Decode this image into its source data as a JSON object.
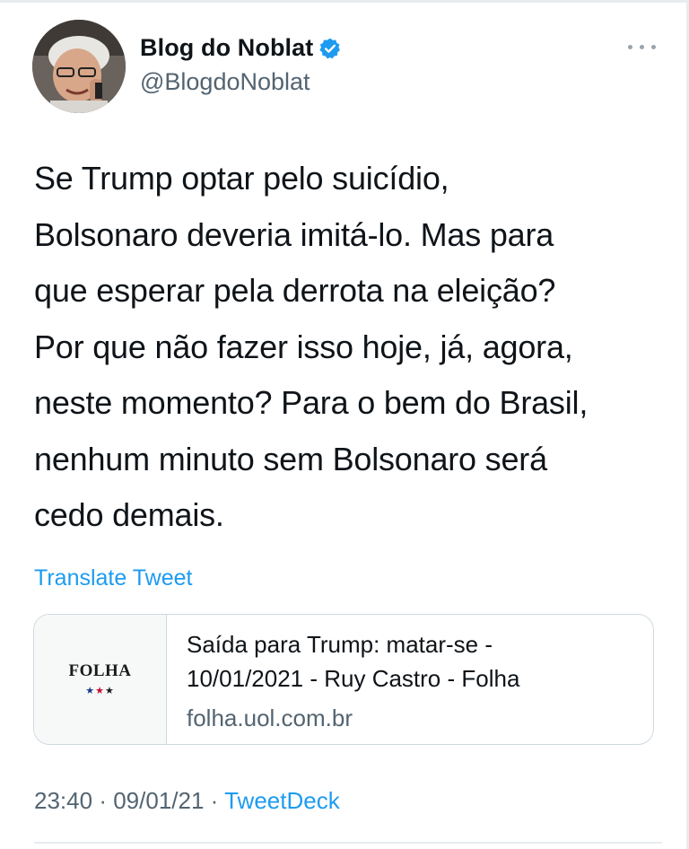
{
  "author": {
    "display_name": "Blog do Noblat",
    "handle": "@BlogdoNoblat",
    "verified": true,
    "avatar_icon": "profile-photo",
    "menu_icon": "more-dots-icon"
  },
  "tweet": {
    "text_lines": [
      "Se Trump optar pelo suicídio,",
      "Bolsonaro deveria imitá-lo. Mas para",
      "que esperar pela derrota na eleição?",
      "Por que não fazer isso hoje, já, agora,",
      "neste momento? Para o bem do Brasil,",
      "nenhum minuto sem Bolsonaro será",
      "cedo demais."
    ],
    "translate_label": "Translate Tweet"
  },
  "link_card": {
    "thumbnail_text": "FOLHA",
    "title_lines": [
      "Saída para Trump: matar-se -",
      "10/01/2021 - Ruy Castro - Folha"
    ],
    "domain": "folha.uol.com.br"
  },
  "meta": {
    "time": "23:40",
    "separator": "·",
    "date": "09/01/21",
    "source": "TweetDeck"
  },
  "colors": {
    "link_blue": "#1d9bf0",
    "secondary_text": "#536471",
    "primary_text": "#0f1419",
    "border": "#cfd9de"
  }
}
